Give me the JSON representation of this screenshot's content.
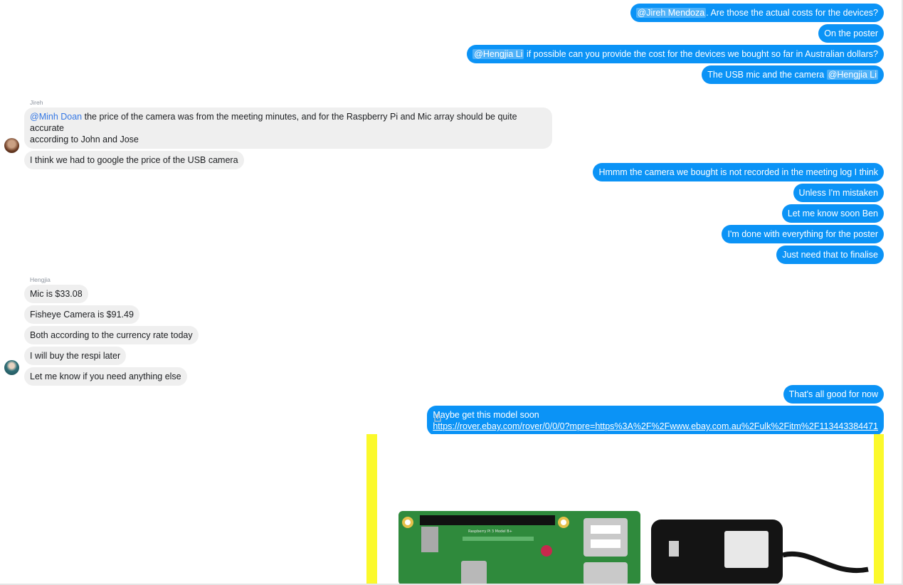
{
  "messages_out_1": {
    "m1_mention": "@Jireh Mendoza",
    "m1_text": ". Are those the actual costs for the devices?",
    "m2_text": "On the poster",
    "m3_mention": "@Hengjia Li",
    "m3_text": " if possible can you provide the cost for the devices we bought so far in Australian dollars?",
    "m4_text": "The USB mic and the camera ",
    "m4_mention": "@Hengjia Li"
  },
  "group_jireh": {
    "sender": "Jireh",
    "m1_mention": "@Minh Doan",
    "m1_line1": " the price of the camera was from the meeting minutes, and for the Raspberry Pi and Mic array should be quite accurate",
    "m1_line2": "according to John and Jose",
    "m2_text": "I think we had to google the price of the USB camera"
  },
  "messages_out_2": [
    "Hmmm the camera we bought is not recorded in the meeting log I think",
    "Unless I'm mistaken",
    "Let me know soon Ben",
    "I'm done with everything for the poster",
    "Just need that to finalise"
  ],
  "group_hengjia": {
    "sender": "Hengjia",
    "messages": [
      "Mic is $33.08",
      "Fisheye Camera is $91.49",
      "Both according to the currency rate today",
      "I will buy the respi later",
      "Let me know if you need anything else"
    ]
  },
  "messages_out_3": {
    "m1_text": "That's all good for now",
    "m2_line1": "Maybe get this model soon",
    "m2_link": "https://rover.ebay.com/rover/0/0/0?mpre=https%3A%2F%2Fwww.ebay.com.au%2Fulk%2Fitm%2F113443384471"
  },
  "icons": {
    "share": "share-icon",
    "attachment": "raspberry-pi-with-power-adapter-image"
  },
  "colors": {
    "outgoing_bubble": "#0b93f6",
    "incoming_bubble": "#efefef",
    "attachment_border": "#fbf92b"
  }
}
